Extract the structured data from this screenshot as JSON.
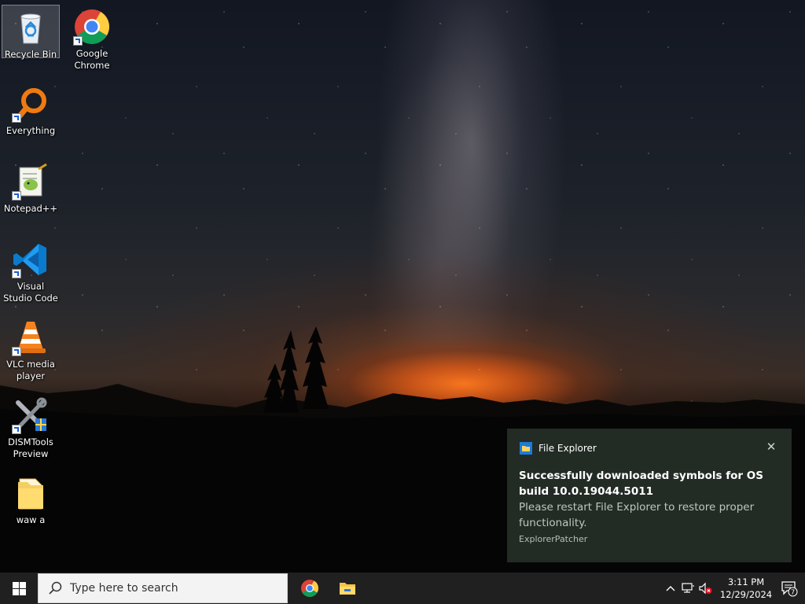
{
  "desktop": {
    "icons": [
      {
        "label": "Recycle Bin",
        "icon": "recycle-bin-icon"
      },
      {
        "label": "Google Chrome",
        "icon": "chrome-icon"
      },
      {
        "label": "Everything",
        "icon": "everything-search-icon"
      },
      {
        "label": "Notepad++",
        "icon": "notepad-plus-plus-icon"
      },
      {
        "label": "Visual Studio Code",
        "icon": "vscode-icon"
      },
      {
        "label": "VLC media player",
        "icon": "vlc-icon"
      },
      {
        "label": "DISMTools Preview",
        "icon": "dismtools-icon"
      },
      {
        "label": "waw a",
        "icon": "folder-icon"
      }
    ]
  },
  "toast": {
    "app_name": "File Explorer",
    "app_icon": "file-explorer-icon",
    "title": "Successfully downloaded symbols for OS build 10.0.19044.5011",
    "body": "Please restart File Explorer to restore proper functionality.",
    "attribution": "ExplorerPatcher",
    "close_icon": "close-icon"
  },
  "taskbar": {
    "search_placeholder": "Type here to search",
    "pinned": [
      {
        "name": "Google Chrome",
        "icon": "chrome-icon"
      },
      {
        "name": "File Explorer",
        "icon": "file-explorer-icon"
      }
    ],
    "tray": {
      "icons": [
        "chevron-up-icon",
        "network-icon",
        "volume-muted-icon"
      ],
      "time": "3:11 PM",
      "date": "12/29/2024",
      "notification_count": "7"
    }
  },
  "colors": {
    "taskbar_bg": "#202020",
    "toast_bg": "#262e28",
    "accent_blue": "#0078d7"
  }
}
